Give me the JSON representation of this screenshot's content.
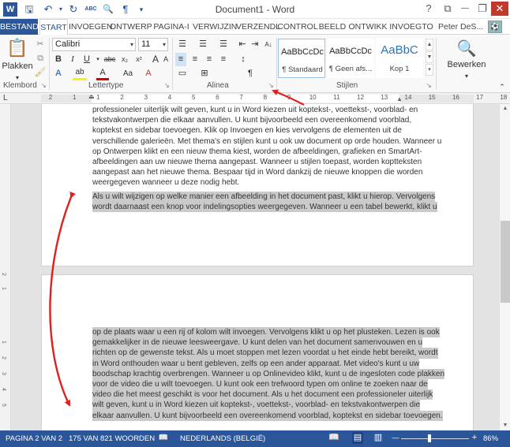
{
  "window": {
    "title": "Document1 - Word",
    "help": "?",
    "ribbon_display": "⧉",
    "minimize": "—",
    "restore": "❐",
    "close": "✕"
  },
  "quick_access": {
    "word_icon": "W",
    "save_icon": "🖫",
    "undo_icon": "↶",
    "redo_icon": "↻",
    "spell_icon": "ABC",
    "print_preview_icon": "🔍",
    "pilcrow_icon": "¶",
    "customize_icon": "▾"
  },
  "tabs": [
    "BESTAND",
    "START",
    "INVOEGEN",
    "ONTWERP",
    "PAGINA-I",
    "VERWIJZIN",
    "VERZENDL",
    "CONTROL",
    "BEELD",
    "ONTWIKK",
    "INVOEGTO"
  ],
  "user": {
    "name": "Peter DeS...",
    "avatar_text": "⚽"
  },
  "ribbon": {
    "clipboard": {
      "label": "Klembord",
      "paste": "Plakken",
      "paste_arrow": "▾"
    },
    "font": {
      "label": "Lettertype",
      "name": "Calibri",
      "size": "11",
      "grow": "A",
      "shrink": "A",
      "change_case": "Aa",
      "clear_format": "A",
      "bold": "B",
      "italic": "I",
      "underline": "U",
      "strike": "abc",
      "subscript": "x₂",
      "superscript": "x²",
      "text_effects": "A",
      "highlight": "ab",
      "font_color": "A"
    },
    "paragraph": {
      "label": "Alinea",
      "bullets": "☰",
      "numbering": "☰",
      "multilevel": "☰",
      "decrease_indent": "⇤",
      "increase_indent": "⇥",
      "sort": "A↓",
      "pilcrow": "¶",
      "line_spacing": "↕",
      "shading": "▭",
      "borders": "⊞"
    },
    "styles": {
      "label": "Stijlen",
      "items": [
        {
          "sample": "AaBbCcDc",
          "name": "¶ Standaard"
        },
        {
          "sample": "AaBbCcDc",
          "name": "¶ Geen afs..."
        },
        {
          "sample": "AaBbC",
          "name": "Kop 1"
        }
      ],
      "up": "▲",
      "down": "▼",
      "more": "▾"
    },
    "editing": {
      "label": "Bewerken",
      "arrow": "▾"
    },
    "launcher": "↘"
  },
  "ruler": {
    "corner": "L",
    "numbers": [
      "2",
      "1",
      "1",
      "2",
      "3",
      "4",
      "5",
      "6",
      "7",
      "8",
      "9",
      "10",
      "11",
      "12",
      "13",
      "14",
      "15",
      "16",
      "17",
      "18"
    ]
  },
  "document": {
    "page1_para1": [
      "professioneler uiterlijk wilt geven, kunt u in Word kiezen uit koptekst-, voettekst-, voorblad- en",
      "tekstvakontwerpen die elkaar aanvullen. U kunt bijvoorbeeld een overeenkomend voorblad,",
      "koptekst en sidebar toevoegen. Klik op Invoegen en kies vervolgens de elementen uit de",
      "verschillende galerieën. Met thema's en stijlen kunt u ook uw document op orde houden. Wanneer u",
      "op Ontwerpen klikt en een nieuw thema kiest, worden de afbeeldingen, grafieken en SmartArt-",
      "afbeeldingen aan uw nieuwe thema aangepast. Wanneer u stijlen toepast, worden koptteksten",
      "aangepast aan het nieuwe thema. Bespaar tijd in Word dankzij de nieuwe knoppen die worden",
      "weergegeven wanneer u deze nodig hebt."
    ],
    "page1_para2": [
      "Als u wilt wijzigen op welke manier een afbeelding in het document past, klikt u hierop. Vervolgens",
      "wordt daarnaast een knop voor indelingsopties weergegeven. Wanneer u een tabel bewerkt, klikt u"
    ],
    "page2_para": [
      "op de plaats waar u een rij of kolom wilt invoegen. Vervolgens klikt u op het plusteken. Lezen is ook",
      "gemakkelijker in de nieuwe leesweergave. U kunt delen van het document samenvouwen en u",
      "richten op de gewenste tekst. Als u moet stoppen met lezen voordat u het einde hebt bereikt, wordt",
      "in Word onthouden waar u bent gebleven, zelfs op een ander apparaat. Met video's kunt u uw",
      "boodschap krachtig overbrengen. Wanneer u op Onlinevideo klikt, kunt u de ingesloten code plakken",
      "voor de video die u wilt toevoegen. U kunt ook een trefwoord typen om online te zoeken naar de",
      "video die het meest geschikt is voor het document. Als u het document een professioneler uiterlijk",
      "wilt geven, kunt u in Word kiezen uit koptekst-, voettekst-, voorblad- en tekstvakontwerpen die",
      "elkaar aanvullen. U kunt bijvoorbeeld een overeenkomend voorblad, koptekst en sidebar toevoegen."
    ]
  },
  "status": {
    "page": "PAGINA 2 VAN 2",
    "words": "175 VAN 821 WOORDEN",
    "proof_icon": "📖",
    "language": "NEDERLANDS (BELGIË)",
    "read_mode_icon": "📖",
    "print_layout_icon": "▤",
    "web_layout_icon": "▥",
    "zoom_out": "—",
    "zoom_in": "+",
    "zoom": "86%",
    "zoom_level": 0.86
  },
  "colors": {
    "accent": "#2b579a",
    "annotation": "#e02020",
    "selection": "#cacaca"
  }
}
